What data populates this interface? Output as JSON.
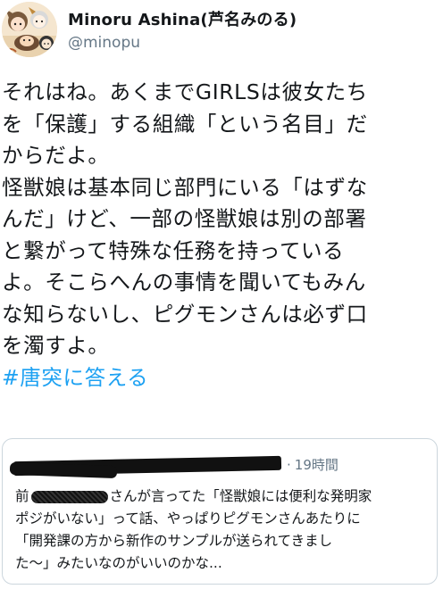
{
  "tweet": {
    "author": {
      "display_name": "Minoru Ashina(芦名みのる)",
      "handle": "@minopu"
    },
    "body_lines": [
      "それはね。あくまでGIRLSは彼女たち",
      "を「保護」する組織「という名目」だ",
      "からだよ。",
      "怪獣娘は基本同じ部門にいる「はずな",
      "んだ」けど、一部の怪獣娘は別の部署",
      "と繋がって特殊な任務を持っている",
      "よ。そこらへんの事情を聞いてもみん",
      "な知らないし、ピグモンさんは必ず口",
      "を濁すよ。"
    ],
    "hashtag": "#唐突に答える"
  },
  "quote": {
    "time": "19時間",
    "line1_prefix": "前",
    "line1_suffix": "さんが言ってた「怪獣娘には便利な発明家",
    "lines": [
      "ポジがいない」って話、やっぱりピグモンさんあたりに",
      "「開発課の方から新作のサンプルが送られてきまし",
      "た〜」みたいなのがいいのかな..."
    ]
  },
  "colors": {
    "link": "#1da1f2",
    "secondary_text": "#657786",
    "primary_text": "#14171a",
    "border": "#ccd6dd"
  }
}
